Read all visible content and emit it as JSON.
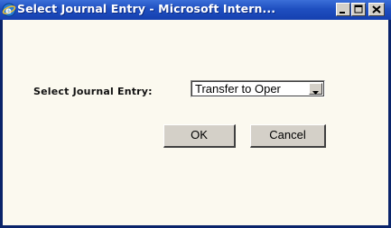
{
  "window": {
    "title": "Select Journal Entry - Microsoft Intern...",
    "icon": "ie-icon",
    "controls": [
      "minimize-icon",
      "maximize-icon",
      "close-icon"
    ]
  },
  "form": {
    "label": "Select Journal Entry:",
    "select_value": "Transfer to Oper"
  },
  "buttons": {
    "ok": "OK",
    "cancel": "Cancel"
  },
  "colors": {
    "titlebar": "#1f4fc0",
    "content_bg": "#fbf9ef",
    "button_face": "#d4d0c8"
  }
}
